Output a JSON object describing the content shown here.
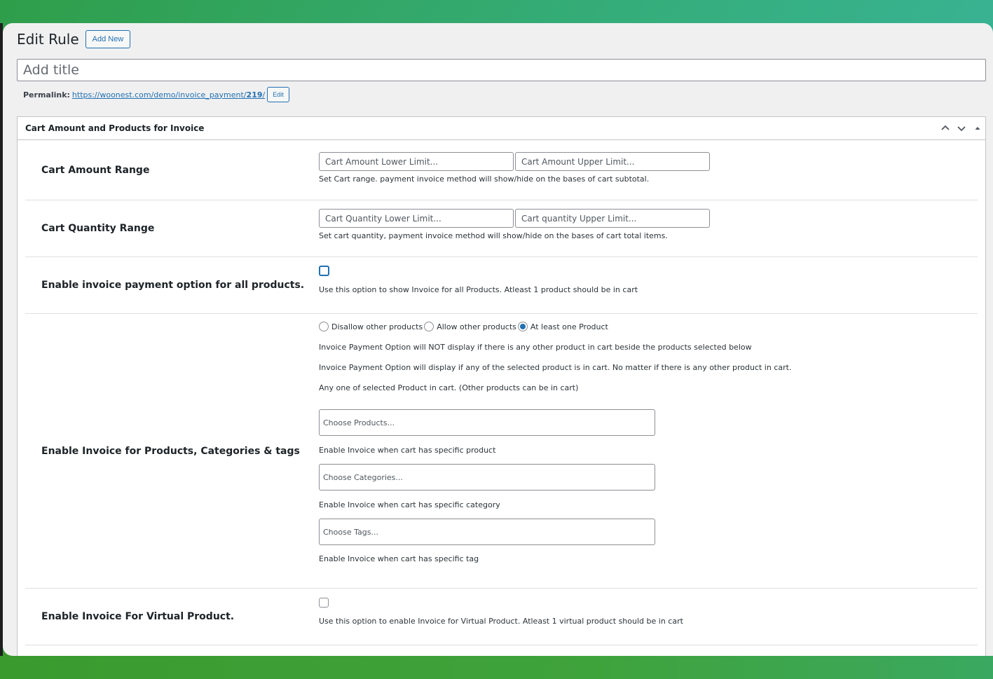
{
  "header": {
    "title": "Edit Rule",
    "add_new": "Add New"
  },
  "title_field": {
    "placeholder": "Add title",
    "value": ""
  },
  "permalink": {
    "label": "Permalink:",
    "url_prefix": "https://woonest.com/demo/invoice_payment/",
    "url_slug": "219",
    "url_suffix": "/",
    "edit_label": "Edit"
  },
  "postbox": {
    "title": "Cart Amount and Products for Invoice",
    "rows": {
      "cart_amount": {
        "label": "Cart Amount Range",
        "lower_placeholder": "Cart Amount Lower Limit...",
        "upper_placeholder": "Cart Amount Upper Limit...",
        "desc": "Set Cart range. payment invoice method will show/hide on the bases of cart subtotal."
      },
      "cart_quantity": {
        "label": "Cart Quantity Range",
        "lower_placeholder": "Cart Quantity Lower Limit...",
        "upper_placeholder": "Cart quantity Upper Limit...",
        "desc": "Set cart quantity, payment invoice method will show/hide on the bases of cart total items."
      },
      "all_products": {
        "label": "Enable invoice payment option for all products.",
        "checked": false,
        "desc": "Use this option to show Invoice for all Products. Atleast 1 product should be in cart"
      },
      "products_cats_tags": {
        "label": "Enable Invoice for Products, Categories & tags",
        "radio_options": [
          "Disallow other products",
          "Allow other products",
          "At least one Product"
        ],
        "radio_selected": "At least one Product",
        "desc_disallow": "Invoice Payment Option will NOT display if there is any other product in cart beside the products selected below",
        "desc_allow": "Invoice Payment Option will display if any of the selected product is in cart. No matter if there is any other product in cart.",
        "desc_atleast": "Any one of selected Product in cart. (Other products can be in cart)",
        "products_placeholder": "Choose Products...",
        "products_desc": "Enable Invoice when cart has specific product",
        "categories_placeholder": "Choose Categories...",
        "categories_desc": "Enable Invoice when cart has specific category",
        "tags_placeholder": "Choose Tags...",
        "tags_desc": "Enable Invoice when cart has specific tag"
      },
      "virtual_product": {
        "label": "Enable Invoice For Virtual Product.",
        "checked": false,
        "desc": "Use this option to enable Invoice for Virtual Product. Atleast 1 virtual product should be in cart"
      }
    }
  },
  "colors": {
    "accent": "#2271b1",
    "border": "#8c8f94",
    "panel_bg": "#f0f0f1"
  },
  "icons": [
    "chevron-up-icon",
    "chevron-down-icon",
    "triangle-up-icon"
  ]
}
